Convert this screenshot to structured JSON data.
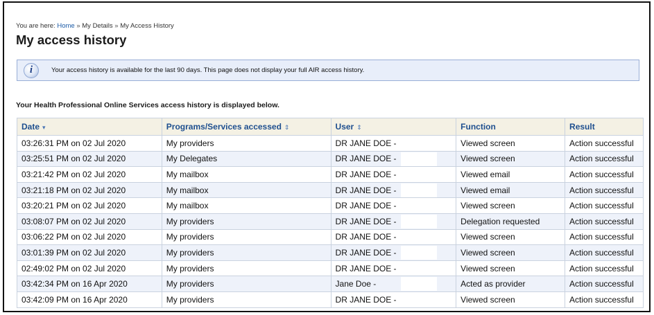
{
  "breadcrumb": {
    "prefix": "You are here:",
    "items": [
      "Home",
      "My Details",
      "My Access History"
    ],
    "separator": "»"
  },
  "page_title": "My access history",
  "notice": {
    "icon": "info-icon",
    "text": "Your access history is available for the last 90 days. This page does not display your full AIR access history."
  },
  "subheading": "Your Health Professional Online Services access history is displayed below.",
  "table": {
    "columns": [
      {
        "label": "Date",
        "sort_indicator": "▾"
      },
      {
        "label": "Programs/Services accessed",
        "sort_indicator": "⇕"
      },
      {
        "label": "User",
        "sort_indicator": "⇕"
      },
      {
        "label": "Function",
        "sort_indicator": ""
      },
      {
        "label": "Result",
        "sort_indicator": ""
      }
    ],
    "rows": [
      {
        "date": "03:26:31 PM on 02 Jul 2020",
        "program": "My providers",
        "user": "DR JANE DOE -",
        "function": "Viewed screen",
        "result": "Action successful"
      },
      {
        "date": "03:25:51 PM on 02 Jul 2020",
        "program": "My Delegates",
        "user": "DR JANE DOE -",
        "function": "Viewed screen",
        "result": "Action successful"
      },
      {
        "date": "03:21:42 PM on 02 Jul 2020",
        "program": "My mailbox",
        "user": "DR JANE DOE -",
        "function": "Viewed email",
        "result": "Action successful"
      },
      {
        "date": "03:21:18 PM on 02 Jul 2020",
        "program": "My mailbox",
        "user": "DR JANE DOE -",
        "function": "Viewed email",
        "result": "Action successful"
      },
      {
        "date": "03:20:21 PM on 02 Jul 2020",
        "program": "My mailbox",
        "user": "DR JANE DOE -",
        "function": "Viewed screen",
        "result": "Action successful"
      },
      {
        "date": "03:08:07 PM on 02 Jul 2020",
        "program": "My providers",
        "user": "DR JANE DOE -",
        "function": "Delegation requested",
        "result": "Action successful"
      },
      {
        "date": "03:06:22 PM on 02 Jul 2020",
        "program": "My providers",
        "user": "DR JANE DOE -",
        "function": "Viewed screen",
        "result": "Action successful"
      },
      {
        "date": "03:01:39 PM on 02 Jul 2020",
        "program": "My providers",
        "user": "DR JANE DOE -",
        "function": "Viewed screen",
        "result": "Action successful"
      },
      {
        "date": "02:49:02 PM on 02 Jul 2020",
        "program": "My providers",
        "user": "DR JANE DOE -",
        "function": "Viewed screen",
        "result": "Action successful"
      },
      {
        "date": "03:42:34 PM on 16 Apr 2020",
        "program": "My providers",
        "user": "Jane Doe -",
        "function": "Acted as provider",
        "result": "Action successful"
      },
      {
        "date": "03:42:09 PM on 16 Apr 2020",
        "program": "My providers",
        "user": "DR JANE DOE -",
        "function": "Viewed screen",
        "result": "Action successful"
      }
    ]
  }
}
